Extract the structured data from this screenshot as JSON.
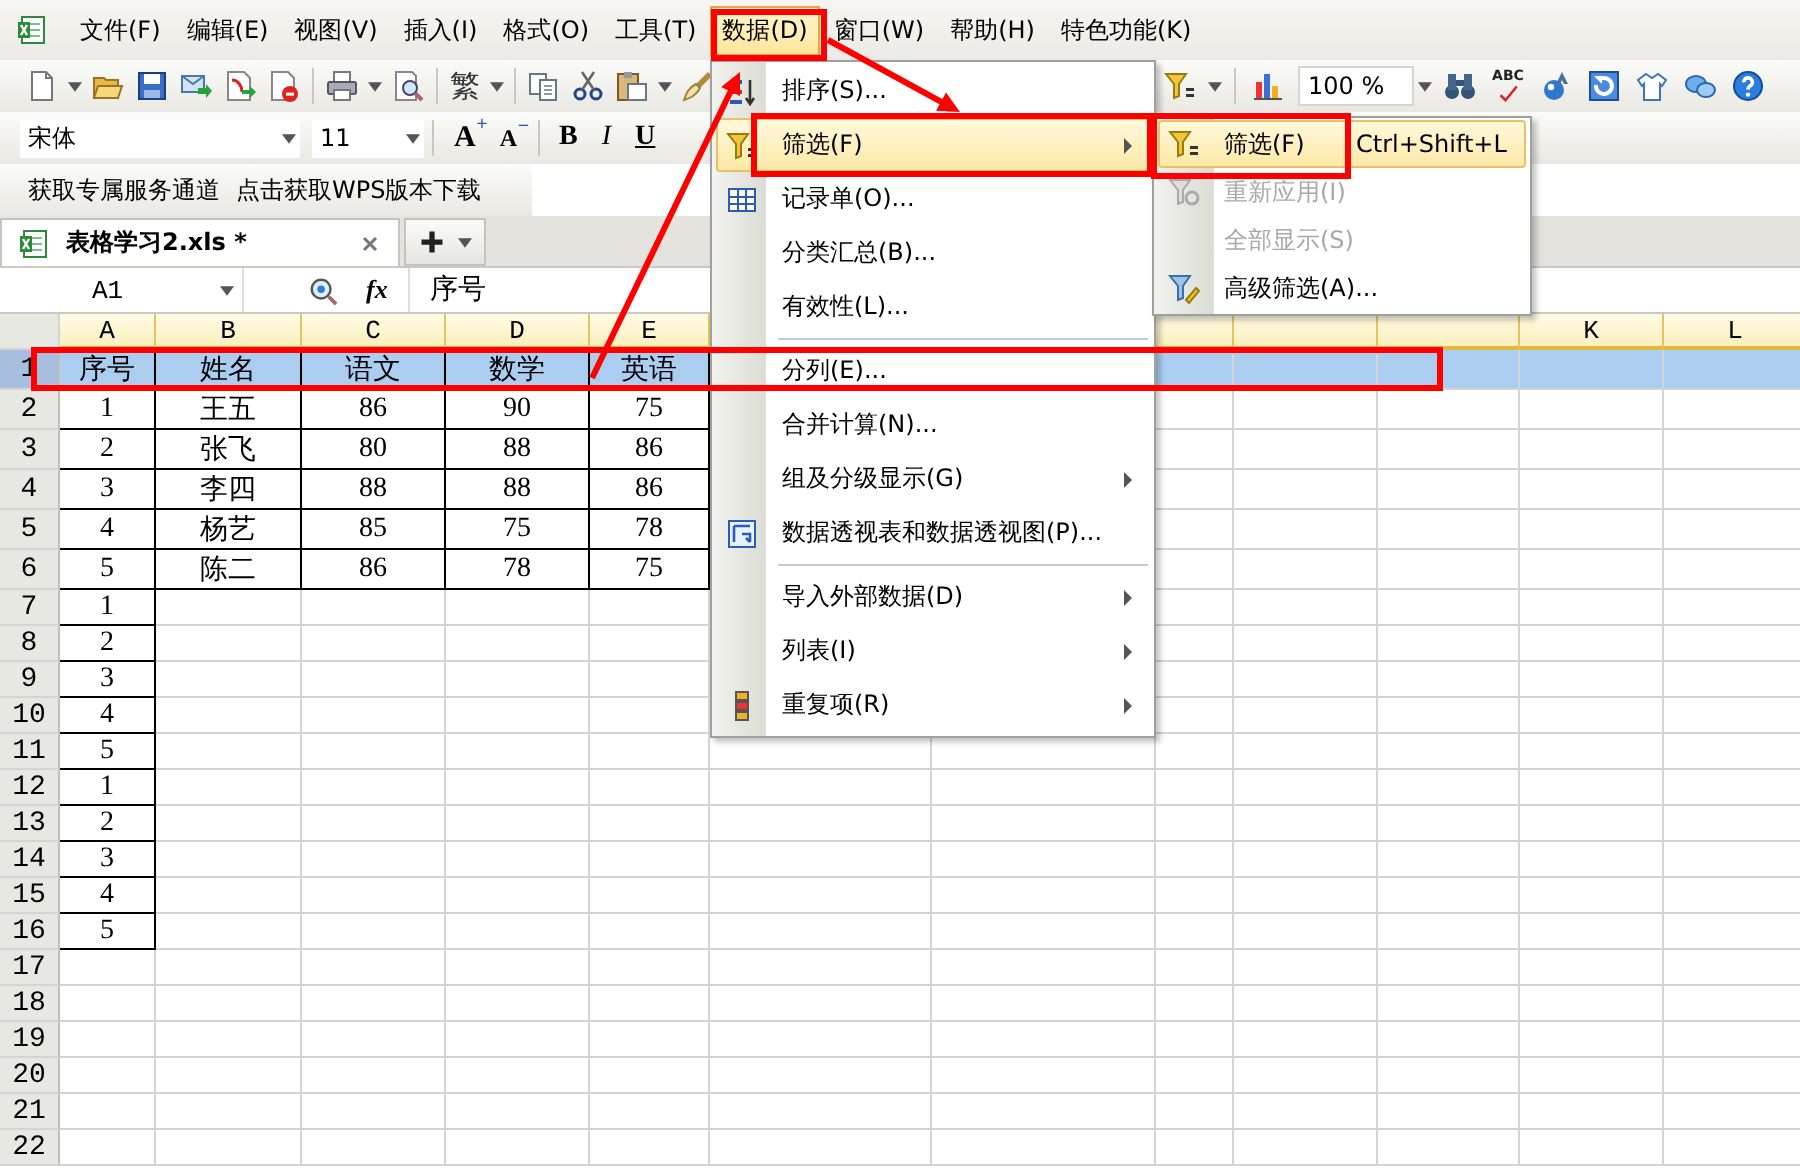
{
  "menubar": [
    {
      "label": "文件(F)",
      "selected": false
    },
    {
      "label": "编辑(E)",
      "selected": false
    },
    {
      "label": "视图(V)",
      "selected": false
    },
    {
      "label": "插入(I)",
      "selected": false
    },
    {
      "label": "格式(O)",
      "selected": false
    },
    {
      "label": "工具(T)",
      "selected": false
    },
    {
      "label": "数据(D)",
      "selected": true
    },
    {
      "label": "窗口(W)",
      "selected": false
    },
    {
      "label": "帮助(H)",
      "selected": false
    },
    {
      "label": "特色功能(K)",
      "selected": false
    }
  ],
  "toolbar": {
    "traditional": "繁",
    "zoom": "100 %",
    "spell_check": "ABC"
  },
  "format_bar": {
    "font": "宋体",
    "size": "11",
    "grow": {
      "label": "A",
      "sign": "+"
    },
    "shrink": {
      "label": "A",
      "sign": "−"
    },
    "styles": [
      "B",
      "I",
      "U"
    ]
  },
  "links": [
    "获取专属服务通道",
    "点击获取WPS版本下载"
  ],
  "tabs": [
    {
      "label": "表格学习2.xls *",
      "selected": true
    }
  ],
  "formula_bar": {
    "cell": "A1",
    "fx": "fx",
    "value": "序号"
  },
  "sheet": {
    "columns": [
      {
        "label": "A"
      },
      {
        "label": "B"
      },
      {
        "label": "C"
      },
      {
        "label": "D"
      },
      {
        "label": "E"
      },
      {},
      {},
      {},
      {},
      {},
      {
        "label": "K"
      },
      {
        "label": "L"
      }
    ],
    "rows": [
      {
        "number": "1",
        "selected": true,
        "cells": [
          "序号",
          "姓名",
          "语文",
          "数学",
          "英语"
        ]
      },
      {
        "number": "2",
        "selected": false,
        "cells": [
          "1",
          "王五",
          "86",
          "90",
          "75"
        ]
      },
      {
        "number": "3",
        "selected": false,
        "cells": [
          "2",
          "张飞",
          "80",
          "88",
          "86"
        ]
      },
      {
        "number": "4",
        "selected": false,
        "cells": [
          "3",
          "李四",
          "88",
          "88",
          "86"
        ]
      },
      {
        "number": "5",
        "selected": false,
        "cells": [
          "4",
          "杨艺",
          "85",
          "75",
          "78"
        ]
      },
      {
        "number": "6",
        "selected": false,
        "cells": [
          "5",
          "陈二",
          "86",
          "78",
          "75"
        ]
      },
      {
        "number": "7",
        "selected": false,
        "cells": [
          "1"
        ]
      },
      {
        "number": "8",
        "selected": false,
        "cells": [
          "2"
        ]
      },
      {
        "number": "9",
        "selected": false,
        "cells": [
          "3"
        ]
      },
      {
        "number": "10",
        "selected": false,
        "cells": [
          "4"
        ]
      },
      {
        "number": "11",
        "selected": false,
        "cells": [
          "5"
        ]
      },
      {
        "number": "12",
        "selected": false,
        "cells": [
          "1"
        ]
      },
      {
        "number": "13",
        "selected": false,
        "cells": [
          "2"
        ]
      },
      {
        "number": "14",
        "selected": false,
        "cells": [
          "3"
        ]
      },
      {
        "number": "15",
        "selected": false,
        "cells": [
          "4"
        ]
      },
      {
        "number": "16",
        "selected": false,
        "cells": [
          "5"
        ]
      },
      {
        "number": "17",
        "selected": false,
        "cells": []
      },
      {
        "number": "18",
        "selected": false,
        "cells": []
      },
      {
        "number": "19",
        "selected": false,
        "cells": []
      },
      {
        "number": "20",
        "selected": false,
        "cells": []
      },
      {
        "number": "21",
        "selected": false,
        "cells": []
      },
      {
        "number": "22",
        "selected": false,
        "cells": []
      }
    ]
  },
  "data_menu": {
    "items": [
      {
        "kind": "item",
        "label": "排序(S)...",
        "selected": false,
        "submenu": false
      },
      {
        "kind": "item",
        "label": "筛选(F)",
        "selected": true,
        "submenu": true
      },
      {
        "kind": "item",
        "label": "记录单(O)...",
        "selected": false,
        "submenu": false
      },
      {
        "kind": "item",
        "label": "分类汇总(B)...",
        "selected": false,
        "submenu": false
      },
      {
        "kind": "item",
        "label": "有效性(L)...",
        "selected": false,
        "submenu": false
      },
      {
        "kind": "separator"
      },
      {
        "kind": "item",
        "label": "分列(E)...",
        "selected": false,
        "submenu": false
      },
      {
        "kind": "item",
        "label": "合并计算(N)...",
        "selected": false,
        "submenu": false
      },
      {
        "kind": "item",
        "label": "组及分级显示(G)",
        "selected": false,
        "submenu": true
      },
      {
        "kind": "item",
        "label": "数据透视表和数据透视图(P)...",
        "selected": false,
        "submenu": false
      },
      {
        "kind": "separator"
      },
      {
        "kind": "item",
        "label": "导入外部数据(D)",
        "selected": false,
        "submenu": true
      },
      {
        "kind": "item",
        "label": "列表(I)",
        "selected": false,
        "submenu": true
      },
      {
        "kind": "item",
        "label": "重复项(R)",
        "selected": false,
        "submenu": true
      }
    ]
  },
  "filter_submenu": {
    "items": [
      {
        "label": "筛选(F)",
        "shortcut": "Ctrl+Shift+L",
        "selected": true,
        "disabled": false
      },
      {
        "label": "重新应用(I)",
        "selected": false,
        "disabled": true
      },
      {
        "label": "全部显示(S)",
        "selected": false,
        "disabled": true
      },
      {
        "label": "高级筛选(A)...",
        "selected": false,
        "disabled": false
      }
    ]
  }
}
